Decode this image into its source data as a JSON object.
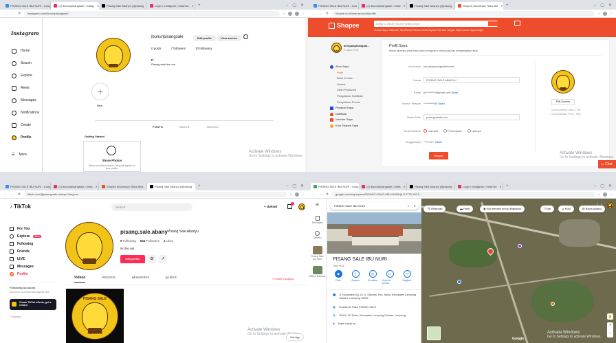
{
  "instagram": {
    "tabs": [
      "PISANG SALE IBU NURI - Goog",
      "(2) ibunuripisangsale • Instag",
      "Pisang Sale Abanyu (@pisang",
      "Login • Instagram | instaTod"
    ],
    "url": "instagram.com/ibunuripisangsale/",
    "logo": "Instagram",
    "nav": [
      {
        "label": "Home",
        "icon": "home-icon"
      },
      {
        "label": "Search",
        "icon": "search-icon"
      },
      {
        "label": "Explore",
        "icon": "compass-icon"
      },
      {
        "label": "Reels",
        "icon": "reels-icon"
      },
      {
        "label": "Messages",
        "icon": "messenger-icon"
      },
      {
        "label": "Notifications",
        "icon": "heart-icon"
      },
      {
        "label": "Create",
        "icon": "plus-square-icon"
      },
      {
        "label": "Profile",
        "icon": "avatar-icon"
      }
    ],
    "more_label": "More",
    "username": "ibunuripisangsale",
    "edit_profile": "Edit profile",
    "view_archive": "View archive",
    "stats": [
      "0 posts",
      "7 followers",
      "10 following"
    ],
    "bio_name": "P",
    "bio_text": "Pisang sale ibu nuri",
    "new_label": "New",
    "profile_tabs": [
      "POSTS",
      "SAVED",
      "TAGGED"
    ],
    "getting_started": "Getting Started",
    "share_photos": "Share Photos",
    "share_photos_desc": "When you share photos, they will appear on your profile.",
    "watermark_title": "Activate Windows",
    "watermark_sub": "Go to Settings to activate Windows."
  },
  "shopee": {
    "tabs": [
      "PISANG SALE IBU NURI - Goo",
      "(2) ibunuripisangsale • Insta",
      "Pisang Sale Abanyu (@pisang",
      "Shopee Indonesia | Situs Bel"
    ],
    "url": "shopee.co.id/user/account/profile",
    "logo": "Shopee",
    "search_placeholder": "Daftar & dapat voucher gratis ongkir",
    "top_links": "Kulkas Sayur   Skincare   Tas Wanita   Pakaian Anak   Sepatu Pria   Jam Tangan   Hijab   Daster   Kipas Angin",
    "seller_name": "kerupukpisangsal...",
    "edit_profile": "✎ Ubah Profil",
    "side_menu": [
      {
        "label": "Akun Saya",
        "icon": "user-icon",
        "sub": [
          "Profil",
          "Bank & Kartu",
          "Alamat",
          "Ubah Password",
          "Pengaturan Notifikasi",
          "Pengaturan Privasi"
        ]
      },
      {
        "label": "Pesanan Saya",
        "icon": "order-icon"
      },
      {
        "label": "Notifikasi",
        "icon": "bell-icon"
      },
      {
        "label": "Voucher Saya",
        "icon": "voucher-icon"
      },
      {
        "label": "Koin Shopee Saya",
        "icon": "coin-icon"
      }
    ],
    "title": "Profil Saya",
    "subtitle": "Kelola informasi profil Anda untuk mengontrol, melindungi dan mengamankan akun",
    "fields": [
      {
        "label": "Username",
        "value": "kerupukpisangsaleibunuri"
      },
      {
        "label": "Nama",
        "value": "PISANG SALE ABANYU"
      },
      {
        "label": "Email",
        "value": "pi*********@gmail.com",
        "link": "Ubah"
      },
      {
        "label": "Nomor Telepon",
        "value": "**********80",
        "link": "Ubah"
      },
      {
        "label": "Nama Toko",
        "value": "pisangsaleibunuri"
      }
    ],
    "gender_label": "Jenis Kelamin",
    "gender_options": [
      "Laki-laki",
      "Perempuan",
      "Lainnya"
    ],
    "dob_label": "Tanggal lahir",
    "dob_value": "**/**/19**",
    "dob_link": "Ubah",
    "save_button": "Simpan",
    "pick_image": "Pilih Gambar",
    "image_note1": "Ukuran gambar: maks. 1 MB",
    "image_note2": "Format gambar: .JPEG, .PNG",
    "chat_label": "Chat",
    "watermark_title": "Activate Windows",
    "watermark_sub": "Go to Settings to activate Windows."
  },
  "tiktok": {
    "tabs": [
      "PISANG SALE IBU NURI - Goog",
      "(2) ibunuripisangsale • Insta",
      "Shopee Indonesia | Situs Bela",
      "Pisang Sale Abanyu (@pisang"
    ],
    "url": "tiktok.com/@pisang.sale.abanyu?lang=en",
    "logo": "TikTok",
    "search_placeholder": "Search",
    "upload": "+ Upload",
    "nav": [
      {
        "label": "For You",
        "icon": "home-icon"
      },
      {
        "label": "Explore",
        "icon": "compass-icon",
        "badge": "New"
      },
      {
        "label": "Following",
        "icon": "following-icon"
      },
      {
        "label": "Friends",
        "icon": "friends-icon"
      },
      {
        "label": "LIVE",
        "icon": "live-icon"
      },
      {
        "label": "Messages",
        "icon": "messages-icon"
      },
      {
        "label": "Profile",
        "icon": "profile-icon"
      }
    ],
    "following_accounts": "Following accounts",
    "following_desc": "Accounts you follow will appear here",
    "effects_title": "Create TikTok effects, get a reward",
    "company": "Company",
    "handle": "pisang.sale.abany",
    "display_name": "Pisang Sale Abanyu",
    "stats": [
      {
        "n": "0",
        "l": "Following"
      },
      {
        "n": "534",
        "l": "Followers"
      },
      {
        "n": "1",
        "l": "Likes"
      }
    ],
    "bio": "No bio yet.",
    "edit_profile": "Edit profile",
    "profile_tabs": [
      "Videos",
      "Reposts",
      "Favorites",
      "Liked"
    ],
    "create_playlist": "+ Create a playlist",
    "get_app": "Get App",
    "logo_text": "PISANG SALE",
    "logo_text2": "ABANYU",
    "watermark_title": "Activate Windows",
    "watermark_sub": "Go to Settings to activate Windows."
  },
  "maps": {
    "tabs": [
      "PISANG SALE IBU NURI - Goog",
      "(2) ibunuripisangsale • Insta",
      "Pisang Sale Abanyu (@pisang",
      "Login • Instagram | instaTod"
    ],
    "url": "google.com/maps/place/PISANG+SALE+IBU+NURI/@-5.2775,105.2...",
    "search_value": "PISANG SALE IBU NURI",
    "rail": [
      "Tersimpan",
      "Terbaru",
      "Pisang Sale Ibu Nuri",
      "Bakso Rahmat"
    ],
    "chips": [
      {
        "label": "Restoran",
        "icon": "restaurant-icon"
      },
      {
        "label": "Hotel",
        "icon": "hotel-icon"
      },
      {
        "label": "Hal menarik untuk dilakukan",
        "icon": "camera-icon"
      },
      {
        "label": "Bar",
        "icon": "bar-icon"
      },
      {
        "label": "Kopi",
        "icon": "coffee-icon"
      },
      {
        "label": "Bawa pulang",
        "icon": "takeout-icon"
      }
    ],
    "place_name": "PISANG SALE IBU NURI",
    "category": "Toko Roti",
    "actions": [
      "Rute",
      "Simpan",
      "Di sekitar",
      "Kirim ke ponsel",
      "Bagikan"
    ],
    "address": "Jl. Nusantara Gg. Lk. II, Sidosari, Kec. Natar, Kabupaten Lampung Selatan, Lampung 35362",
    "located_in": "Terletak di: Ruko PISANG SALE",
    "plus_code": "7WXV+2C Natar, Kabupaten Lampung Selatan, Lampung",
    "claim": "Klaim bisnis ini",
    "google": "Google",
    "watermark_title": "Activate Windows",
    "watermark_sub": "Go to Settings to activate Windows."
  }
}
